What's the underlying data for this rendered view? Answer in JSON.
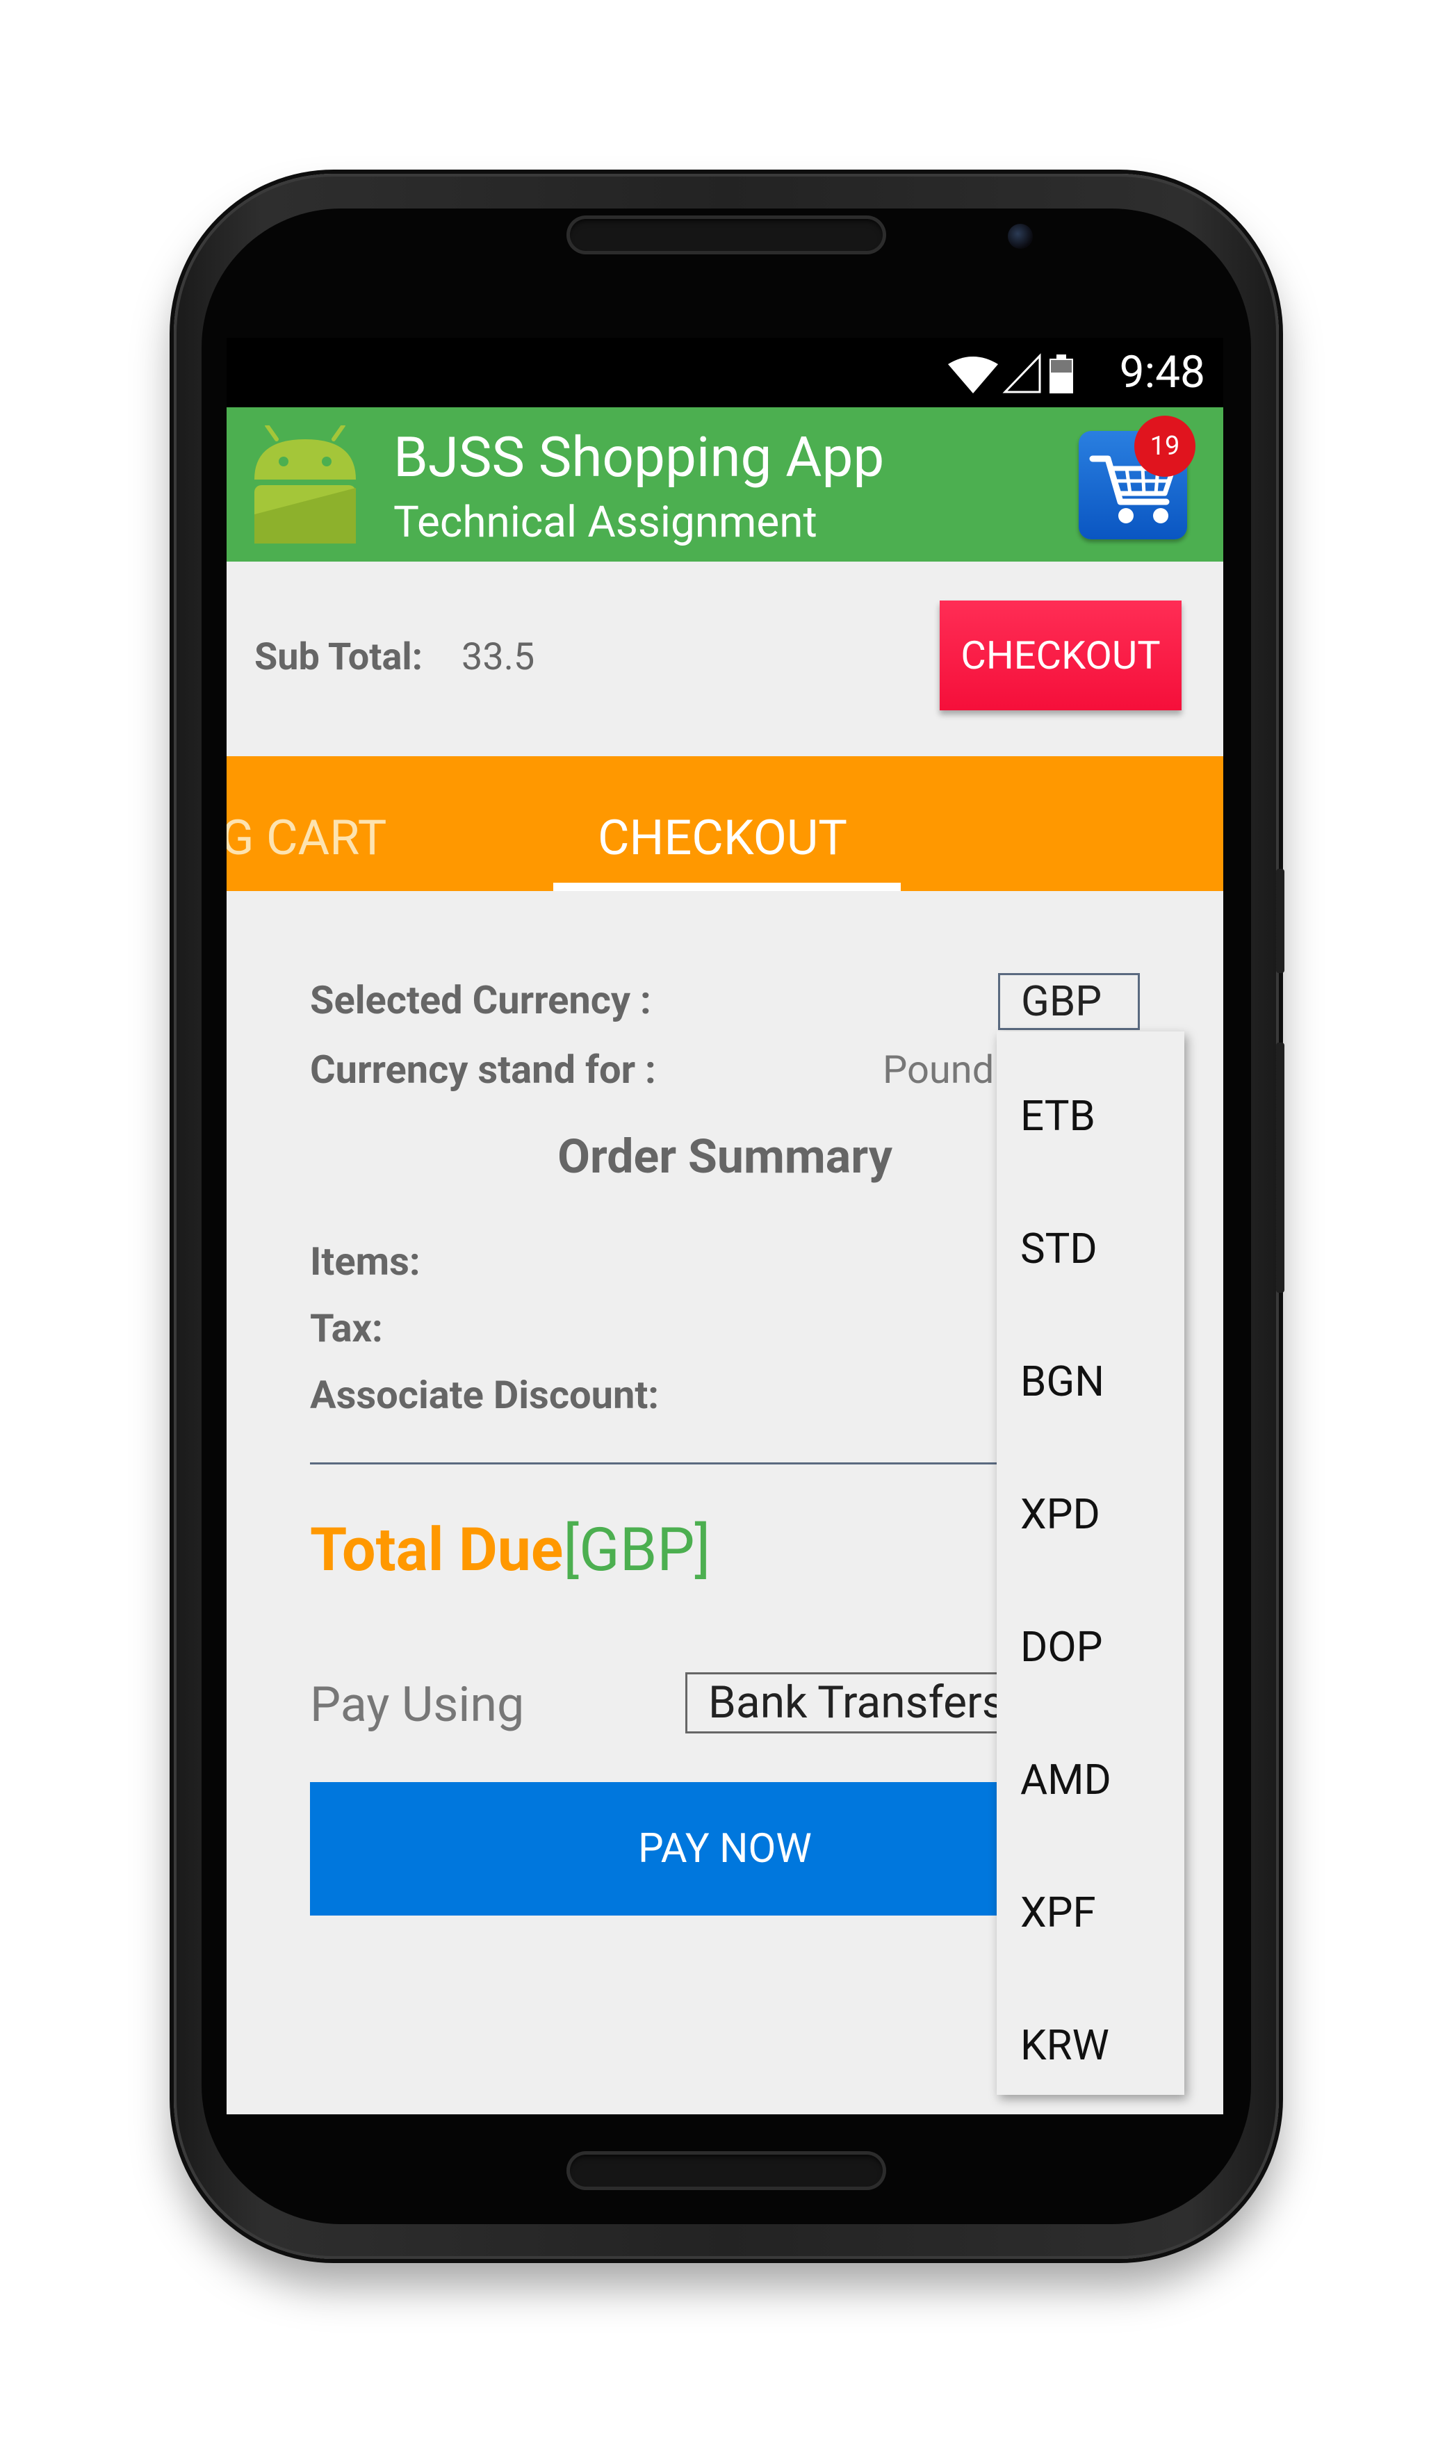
{
  "status_bar": {
    "time": "9:48"
  },
  "app_bar": {
    "title": "BJSS Shopping App",
    "subtitle": "Technical Assignment",
    "cart_badge": "19"
  },
  "subtotal": {
    "label": "Sub Total:",
    "value": "33.5",
    "checkout_button": "CHECKOUT"
  },
  "tabs": [
    {
      "label": "NG CART",
      "selected": false
    },
    {
      "label": "CHECKOUT",
      "selected": true
    }
  ],
  "checkout": {
    "selected_currency_label": "Selected Currency :",
    "selected_currency_value": "GBP",
    "currency_stand_for_label": "Currency stand for :",
    "currency_stand_for_value": "Pound",
    "order_summary_title": "Order Summary",
    "items_label": "Items:",
    "tax_label": "Tax:",
    "associate_discount_label": "Associate Discount:",
    "total_due_label": "Total Due",
    "total_due_currency": "[GBP]",
    "pay_using_label": "Pay Using",
    "pay_using_value": "Bank Transfers",
    "pay_now_button": "PAY NOW"
  },
  "currency_dropdown": {
    "options": [
      "ETB",
      "STD",
      "BGN",
      "XPD",
      "DOP",
      "AMD",
      "XPF",
      "KRW"
    ]
  },
  "colors": {
    "app_bar": "#4caf50",
    "tab_bar": "#ff9800",
    "checkout_button": "#ff1744",
    "pay_now_button": "#0077dd",
    "badge": "#e0141e"
  }
}
